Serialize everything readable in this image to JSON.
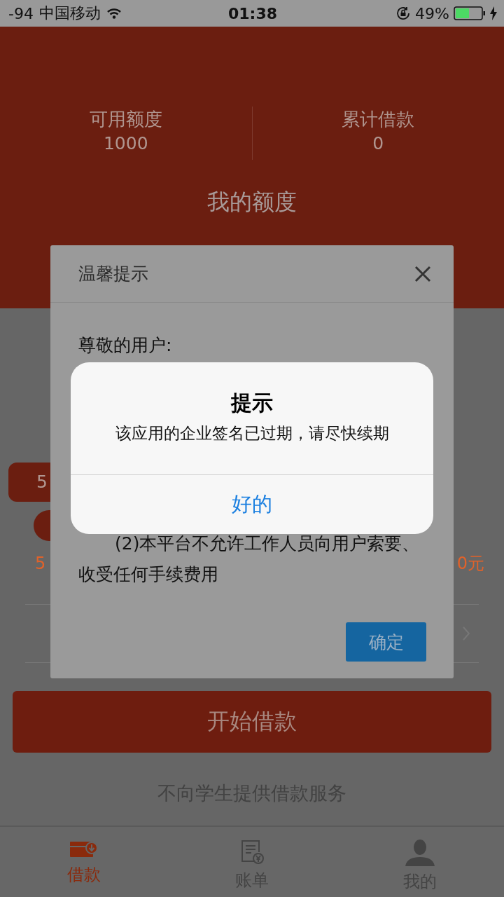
{
  "status_bar": {
    "signal": "-94",
    "carrier": "中国移动",
    "time": "01:38",
    "battery": "49%"
  },
  "header": {
    "stats": [
      {
        "label": "可用额度",
        "value": "1000"
      },
      {
        "label": "累计借款",
        "value": "0"
      }
    ],
    "title": "我的额度"
  },
  "slider": {
    "bubble": "5",
    "min_label": "5",
    "max_label": "0元"
  },
  "start_button": "开始借款",
  "notice": "不向学生提供借款服务",
  "tabs": [
    {
      "label": "借款",
      "selected": true,
      "kind": "wallet"
    },
    {
      "label": "账单",
      "selected": false,
      "kind": "bill"
    },
    {
      "label": "我的",
      "selected": false,
      "kind": "person"
    }
  ],
  "dialog": {
    "title": "温馨提示",
    "greeting": "尊敬的用户:",
    "rule": "(2)本平台不允许工作人员向用户索要、收受任何手续费用",
    "confirm": "确定"
  },
  "alert": {
    "title": "提示",
    "message": "该应用的企业签名已过期，请尽快续期",
    "button": "好的"
  }
}
